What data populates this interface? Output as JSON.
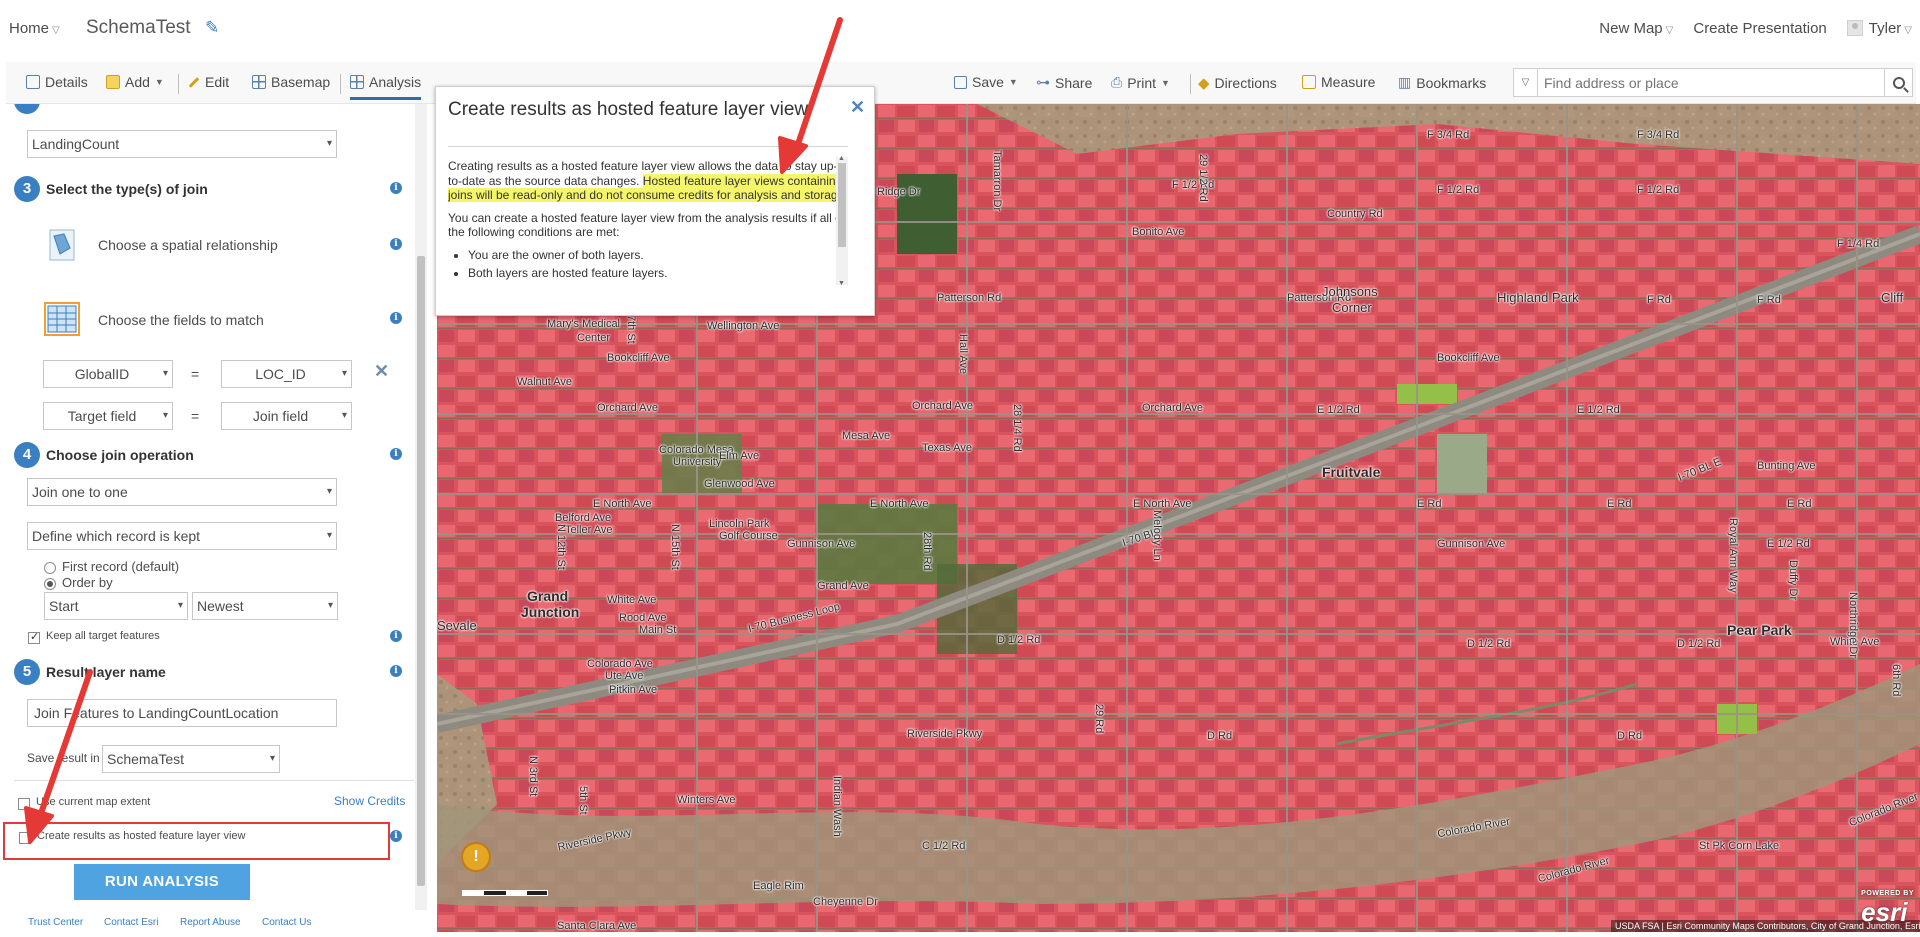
{
  "header": {
    "home": "Home",
    "map_title": "SchemaTest",
    "new_map": "New Map",
    "create_presentation": "Create Presentation",
    "user": "Tyler"
  },
  "toolbar": {
    "details": "Details",
    "add": "Add",
    "edit": "Edit",
    "basemap": "Basemap",
    "analysis": "Analysis",
    "save": "Save",
    "share": "Share",
    "print": "Print",
    "directions": "Directions",
    "measure": "Measure",
    "bookmarks": "Bookmarks",
    "search_placeholder": "Find address or place"
  },
  "panel": {
    "layer_select": "LandingCount",
    "step3": {
      "num": "3",
      "title": "Select the type(s) of join"
    },
    "spatial_relationship": "Choose a spatial relationship",
    "fields_to_match": "Choose the fields to match",
    "field_row1": {
      "target": "GlobalID",
      "eq": "=",
      "join": "LOC_ID"
    },
    "field_row2": {
      "target": "Target field",
      "eq": "=",
      "join": "Join field"
    },
    "step4": {
      "num": "4",
      "title": "Choose join operation"
    },
    "join_operation": "Join one to one",
    "record_kept": "Define which record is kept",
    "first_record": "First record (default)",
    "order_by": "Order by",
    "order_field": "Start",
    "order_dir": "Newest",
    "keep_all": "Keep all target features",
    "step5": {
      "num": "5",
      "title": "Result layer name"
    },
    "result_name": "Join Features to LandingCountLocation",
    "save_in_label": "Save result in",
    "save_in_value": "SchemaTest",
    "use_extent": "Use current map extent",
    "show_credits": "Show Credits",
    "hosted_view": "Create results as hosted feature layer view",
    "run_analysis": "RUN ANALYSIS",
    "footer": [
      "Trust Center",
      "Contact Esri",
      "Report Abuse",
      "Contact Us"
    ]
  },
  "popup": {
    "title": "Create results as hosted feature layer view",
    "p1_plain": "Creating results as a hosted feature layer view allows the data to stay up-to-date as the source data changes. ",
    "p1_highlight": "Hosted feature layer views containing joins will be read-only and do not consume credits for analysis and storage.",
    "p2": "You can create a hosted feature layer view from the analysis results if all of the following conditions are met:",
    "li1": "You are the owner of both layers.",
    "li2": "Both layers are hosted feature layers."
  },
  "map": {
    "labels": [
      "F 3/4 Rd",
      "F 3/4 Rd",
      "F 1/2 Rd",
      "F 1/2 Rd",
      "F 1/2 Rd",
      "F 1/4 Rd",
      "Ridge Dr",
      "Country Rd",
      "Bonito Ave",
      "Patterson Rd",
      "Patterson Rd",
      "Johnsons",
      "Corner",
      "Highland Park",
      "F Rd",
      "F Rd",
      "Cliff",
      "Wellington Ave",
      "Mary's Medical",
      "Center",
      "Bookcliff Ave",
      "Bookcliff Ave",
      "Walnut Ave",
      "Orchard Ave",
      "Orchard Ave",
      "Orchard Ave",
      "E 1/2 Rd",
      "E 1/2 Rd",
      "Mesa Ave",
      "Texas Ave",
      "Colorado Mesa",
      "University",
      "Elm Ave",
      "Fruitvale",
      "Glenwood Ave",
      "I-70 BL E",
      "Bunting Ave",
      "E North Ave",
      "E North Ave",
      "E North Ave",
      "E Rd",
      "E Rd",
      "E Rd",
      "Belford Ave",
      "Teller Ave",
      "Lincoln Park",
      "Golf Course",
      "Gunnison Ave",
      "Gunnison Ave",
      "E 1/2 Rd",
      "I-70 BL",
      "Grand Ave",
      "Grand",
      "Junction",
      "White Ave",
      "Rood Ave",
      "Main St",
      "I-70 Business Loop",
      "D 1/2 Rd",
      "D 1/2 Rd",
      "D 1/2 Rd",
      "Pear Park",
      "White Ave",
      "Colorado Ave",
      "Ute Ave",
      "Pitkin Ave",
      "Riverside Pkwy",
      "D Rd",
      "D Rd",
      "Winters Ave",
      "Colorado River",
      "Colorado River",
      "Riverside Pkwy",
      "C 1/2 Rd",
      "Eagle Rim",
      "Cheyenne Dr",
      "Santa Clara Ave",
      "Colorado River",
      "St Pk Corn Lake",
      "Tamarron Dr",
      "29 1/2 Rd",
      "Hall Ave",
      "28 1/4 Rd",
      "Melody Ln",
      "Sevale",
      "N 12th St",
      "N 15th St",
      "N 7th St",
      "28th Rd",
      "29 Rd",
      "Indian Wash",
      "Royal Ann Way",
      "Duffy Dr",
      "Northridge Dr",
      "N 3rd St",
      "5th St",
      "6th Rd"
    ],
    "attribution": "USDA FSA | Esri Community Maps Contributors, City of Grand Junction, Esri, HERE, Garmin, SafeGraph, INCREMENT P, METI/NASA, USGS, Bure...",
    "powered_by": "POWERED BY",
    "esri": "esri",
    "warning": "!"
  },
  "colors": {
    "accent": "#3a7fc1",
    "run_button": "#4ea3e0",
    "highlight": "#f5f56a",
    "annotation_red": "#e53935",
    "parcel_red": "#e8525c"
  },
  "icons": [
    "pencil-icon",
    "details-icon",
    "add-icon",
    "edit-icon",
    "basemap-icon",
    "analysis-icon",
    "save-icon",
    "share-icon",
    "print-icon",
    "directions-icon",
    "measure-icon",
    "bookmarks-icon",
    "search-icon",
    "info-icon",
    "spatial-relationship-icon",
    "fields-table-icon",
    "remove-icon",
    "close-icon",
    "warning-icon",
    "annotation-arrow"
  ]
}
